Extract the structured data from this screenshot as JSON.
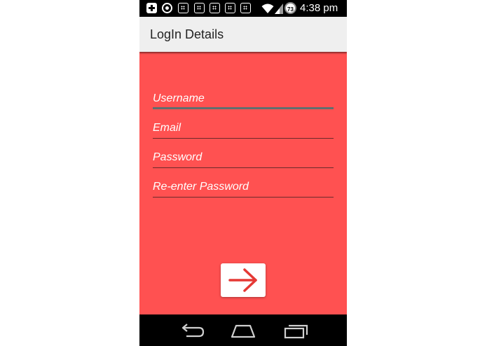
{
  "status_bar": {
    "icons": [
      "plus-box-icon",
      "whatsapp-icon",
      "app-grid-icon",
      "app-grid-icon",
      "app-grid-icon",
      "app-grid-icon",
      "app-grid-icon",
      "wifi-icon",
      "signal-icon",
      "battery-icon"
    ],
    "battery_level": "73",
    "time": "4:38  pm"
  },
  "action_bar": {
    "title": "LogIn Details"
  },
  "form": {
    "fields": [
      {
        "name": "username",
        "placeholder": "Username",
        "value": "",
        "focused": true
      },
      {
        "name": "email",
        "placeholder": "Email",
        "value": "",
        "focused": false
      },
      {
        "name": "password",
        "placeholder": "Password",
        "value": "",
        "focused": false
      },
      {
        "name": "reenter-password",
        "placeholder": "Re-enter Password",
        "value": "",
        "focused": false
      }
    ],
    "next_icon": "arrow-right-icon"
  },
  "nav_bar": {
    "icons": [
      "back-icon",
      "home-icon",
      "recent-apps-icon"
    ]
  },
  "colors": {
    "background": "#ff5151",
    "accent": "#e53935",
    "action_bar": "#efefef",
    "status_bar": "#000000"
  }
}
